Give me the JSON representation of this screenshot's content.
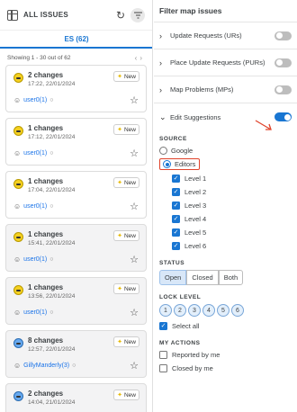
{
  "left": {
    "title": "ALL ISSUES",
    "tab_label": "ES (62)",
    "range_text": "Showing 1 - 30 out of 62",
    "cards": [
      {
        "title": "2 changes",
        "time": "17:22, 22/01/2024",
        "badge": "New",
        "user": "user0(1)",
        "style": "white",
        "icon": "yellow"
      },
      {
        "title": "1 changes",
        "time": "17:12, 22/01/2024",
        "badge": "New",
        "user": "user0(1)",
        "style": "white",
        "icon": "yellow"
      },
      {
        "title": "1 changes",
        "time": "17:04, 22/01/2024",
        "badge": "New",
        "user": "user0(1)",
        "style": "white",
        "icon": "yellow"
      },
      {
        "title": "1 changes",
        "time": "15:41, 22/01/2024",
        "badge": "New",
        "user": "user0(1)",
        "style": "gray",
        "icon": "yellow"
      },
      {
        "title": "1 changes",
        "time": "13:56, 22/01/2024",
        "badge": "New",
        "user": "user0(1)",
        "style": "gray",
        "icon": "yellow"
      },
      {
        "title": "8 changes",
        "time": "12:57, 22/01/2024",
        "badge": "New",
        "user": "GillyManderly(3)",
        "style": "gray",
        "icon": "blue"
      },
      {
        "title": "2 changes",
        "time": "14:04, 21/01/2024",
        "badge": "New",
        "user": "",
        "style": "gray",
        "icon": "blue"
      }
    ]
  },
  "right": {
    "title": "Filter map issues",
    "layers": [
      {
        "label": "Update Requests (URs)",
        "on": false
      },
      {
        "label": "Place Update Requests (PURs)",
        "on": false
      },
      {
        "label": "Map Problems (MPs)",
        "on": false
      },
      {
        "label": "Edit Suggestions",
        "on": true
      }
    ],
    "source": {
      "title": "SOURCE",
      "google": "Google",
      "editors": "Editors",
      "levels": [
        "Level 1",
        "Level 2",
        "Level 3",
        "Level 4",
        "Level 5",
        "Level 6"
      ]
    },
    "status": {
      "title": "STATUS",
      "options": [
        "Open",
        "Closed",
        "Both"
      ],
      "selected": "Open"
    },
    "lock_level": {
      "title": "LOCK LEVEL",
      "levels": [
        "1",
        "2",
        "3",
        "4",
        "5",
        "6"
      ],
      "select_all": "Select all"
    },
    "my_actions": {
      "title": "MY ACTIONS",
      "reported": "Reported by me",
      "closed": "Closed by me"
    }
  },
  "colors": {
    "accent": "#1976d2",
    "annotation": "#e0432b"
  }
}
